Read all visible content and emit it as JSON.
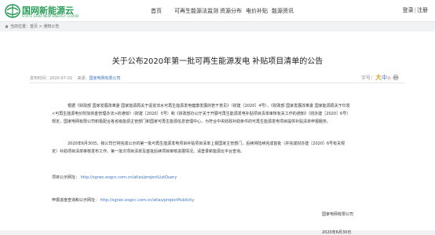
{
  "header": {
    "logo_text": "国网新能源云",
    "logo_sub": "STATE GRID NEW ENERGY CLOUD",
    "nav": [
      "首页",
      "可再生能源法监测",
      "资源分布",
      "电价补贴",
      "能源资讯"
    ],
    "login": "登录",
    "register": "注册"
  },
  "breadcrumb": {
    "current_label": "当前位置：",
    "home": "首页",
    "sep1": " > ",
    "section": "通知公告"
  },
  "article": {
    "title": "关于公布2020年第一批可再生能源发电 补贴项目清单的公告",
    "date_label": "发布时间：",
    "date": "2020-07-01",
    "source_label": "来源：",
    "source": "国家电网有限公司",
    "font_label": "字号：",
    "font_big": "大",
    "font_mid": "中",
    "font_small": "小",
    "p1": "根据《财政部 国家发展改革委 国家能源局关于促进非水可再生能源发电健康发展的若干意见》（财建［2020］4号）、《财政部 国家发展改革委 国家能源局关于印发<可再生能源电价附加资金管理办法>的通知》（财建［2020］5号）和《财政部办公厅关于开展可再生能源发电补贴项目清单审核有关工作的通知》（财办建［2020］6号）规定，国家电网有限公司积极配合各省级能源主管部门和国家可再生能源信息管理中心，为符合中央财政补助条件的可再生能源发电项目提供补贴清单申报服务。",
    "p2": "2020年6月30日，我公司已将完成公示的第一批可再生能源发电项目补贴项目清单上报国家主管部门，后续将陆续完成首批（并完成财办建［2020］6号有关规定）补助项目清单审核发布工作。第一批次项目清单及首批后续项目审核进展情况，请登录新能源云平台查询。",
    "link1_label": "项目公示网址：",
    "link1_url": "http://sgnec.esgcc.com.cn/atlas/projectListQuery",
    "link2_label": "申报进度查询和公示网址：",
    "link2_url": "http://sgnec.esgcc.com.cn/atlas/projectPublicity",
    "sign_org": "国家电网有限公司",
    "sign_date": "2020年6月30日"
  },
  "colors": {
    "brand": "#2a9d57",
    "link": "#3b74c9",
    "page_bg": "#f1f2f4"
  }
}
